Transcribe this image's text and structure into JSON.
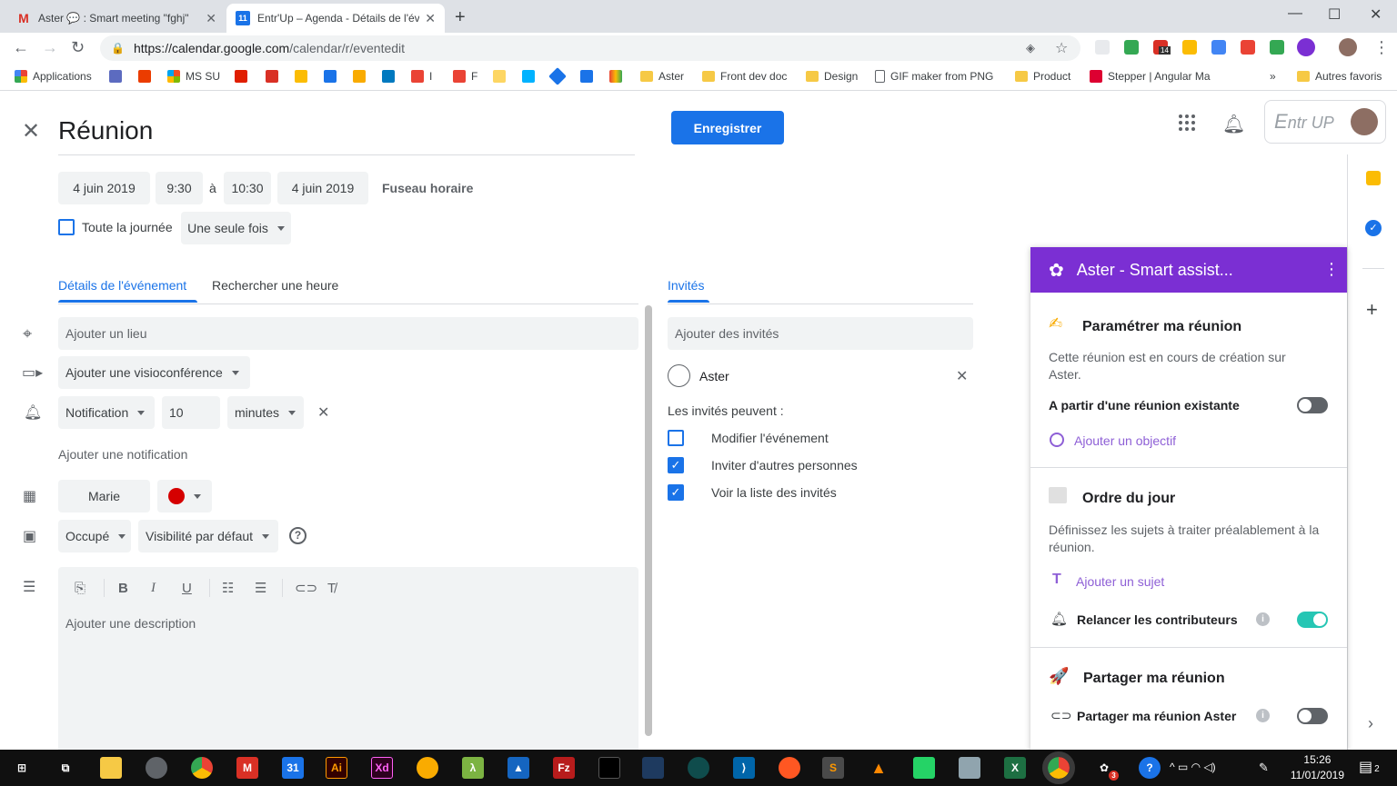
{
  "browser": {
    "tabs": [
      {
        "title": "Aster 💬 : Smart meeting \"fghj\"",
        "favicon": "gmail-icon",
        "active": false
      },
      {
        "title": "Entr'Up – Agenda - Détails de l'év",
        "favicon": "calendar-icon",
        "active": true
      }
    ],
    "new_tab": "+",
    "window_controls": {
      "minimize": "—",
      "maximize": "☐",
      "close": "✕"
    },
    "url_host": "https://calendar.google.com",
    "url_path": "/calendar/r/eventedit",
    "bookmarks": [
      {
        "label": "Applications",
        "kind": "apps"
      },
      {
        "label": "MS SU",
        "kind": "ms"
      },
      {
        "label": "I",
        "kind": "ext"
      },
      {
        "label": "F",
        "kind": "ext"
      },
      {
        "label": "Aster",
        "kind": "folder"
      },
      {
        "label": "Front dev doc",
        "kind": "folder"
      },
      {
        "label": "Design",
        "kind": "folder"
      },
      {
        "label": "GIF maker from PNG",
        "kind": "page"
      },
      {
        "label": "Product",
        "kind": "folder"
      },
      {
        "label": "Stepper | Angular Ma",
        "kind": "angular"
      },
      {
        "label": "»",
        "kind": "more"
      },
      {
        "label": "Autres favoris",
        "kind": "folder"
      }
    ],
    "extension_badge": "14"
  },
  "event": {
    "title": "Réunion",
    "save_label": "Enregistrer",
    "start_date": "4 juin 2019",
    "start_time": "9:30",
    "to": "à",
    "end_time": "10:30",
    "end_date": "4 juin 2019",
    "timezone": "Fuseau horaire",
    "all_day": "Toute la journée",
    "recurrence": "Une seule fois",
    "tabs": [
      "Détails de l'événement",
      "Rechercher une heure"
    ],
    "location_placeholder": "Ajouter un lieu",
    "video": "Ajouter une visioconférence",
    "notification_type": "Notification",
    "notification_value": "10",
    "notification_unit": "minutes",
    "add_notification": "Ajouter une notification",
    "calendar_owner": "Marie",
    "calendar_color": "#d50000",
    "availability": "Occupé",
    "visibility": "Visibilité par défaut",
    "description_placeholder": "Ajouter une description",
    "format_toolbar": [
      "attach",
      "B",
      "I",
      "U",
      "ol",
      "ul",
      "link",
      "clear"
    ]
  },
  "guests": {
    "tab": "Invités",
    "add_placeholder": "Ajouter des invités",
    "list": [
      {
        "name": "Aster"
      }
    ],
    "permissions_title": "Les invités peuvent :",
    "permissions": [
      {
        "label": "Modifier l'événement",
        "checked": false
      },
      {
        "label": "Inviter d'autres personnes",
        "checked": true
      },
      {
        "label": "Voir la liste des invités",
        "checked": true
      }
    ]
  },
  "aster": {
    "header": "Aster - Smart assist...",
    "sections": {
      "setup": {
        "title": "Paramétrer ma réunion",
        "text": "Cette réunion est en cours de création sur Aster.",
        "from_existing": "A partir d'une réunion existante",
        "from_existing_on": false,
        "add_objective": "Ajouter un objectif"
      },
      "agenda": {
        "title": "Ordre du jour",
        "text": "Définissez les sujets à traiter préalablement à la réunion.",
        "add_topic": "Ajouter un sujet",
        "remind": "Relancer les contributeurs",
        "remind_on": true
      },
      "share": {
        "title": "Partager ma réunion",
        "share_label": "Partager ma réunion Aster",
        "share_on": false
      }
    }
  },
  "header_brand": "ntr UP",
  "taskbar": {
    "time": "15:26",
    "date": "11/01/2019",
    "notification_count": "2",
    "chrome_badge": "3"
  },
  "colors": {
    "accent": "#1a73e8",
    "aster_purple": "#7b2fd3",
    "toggle_on": "#26c6b4"
  }
}
